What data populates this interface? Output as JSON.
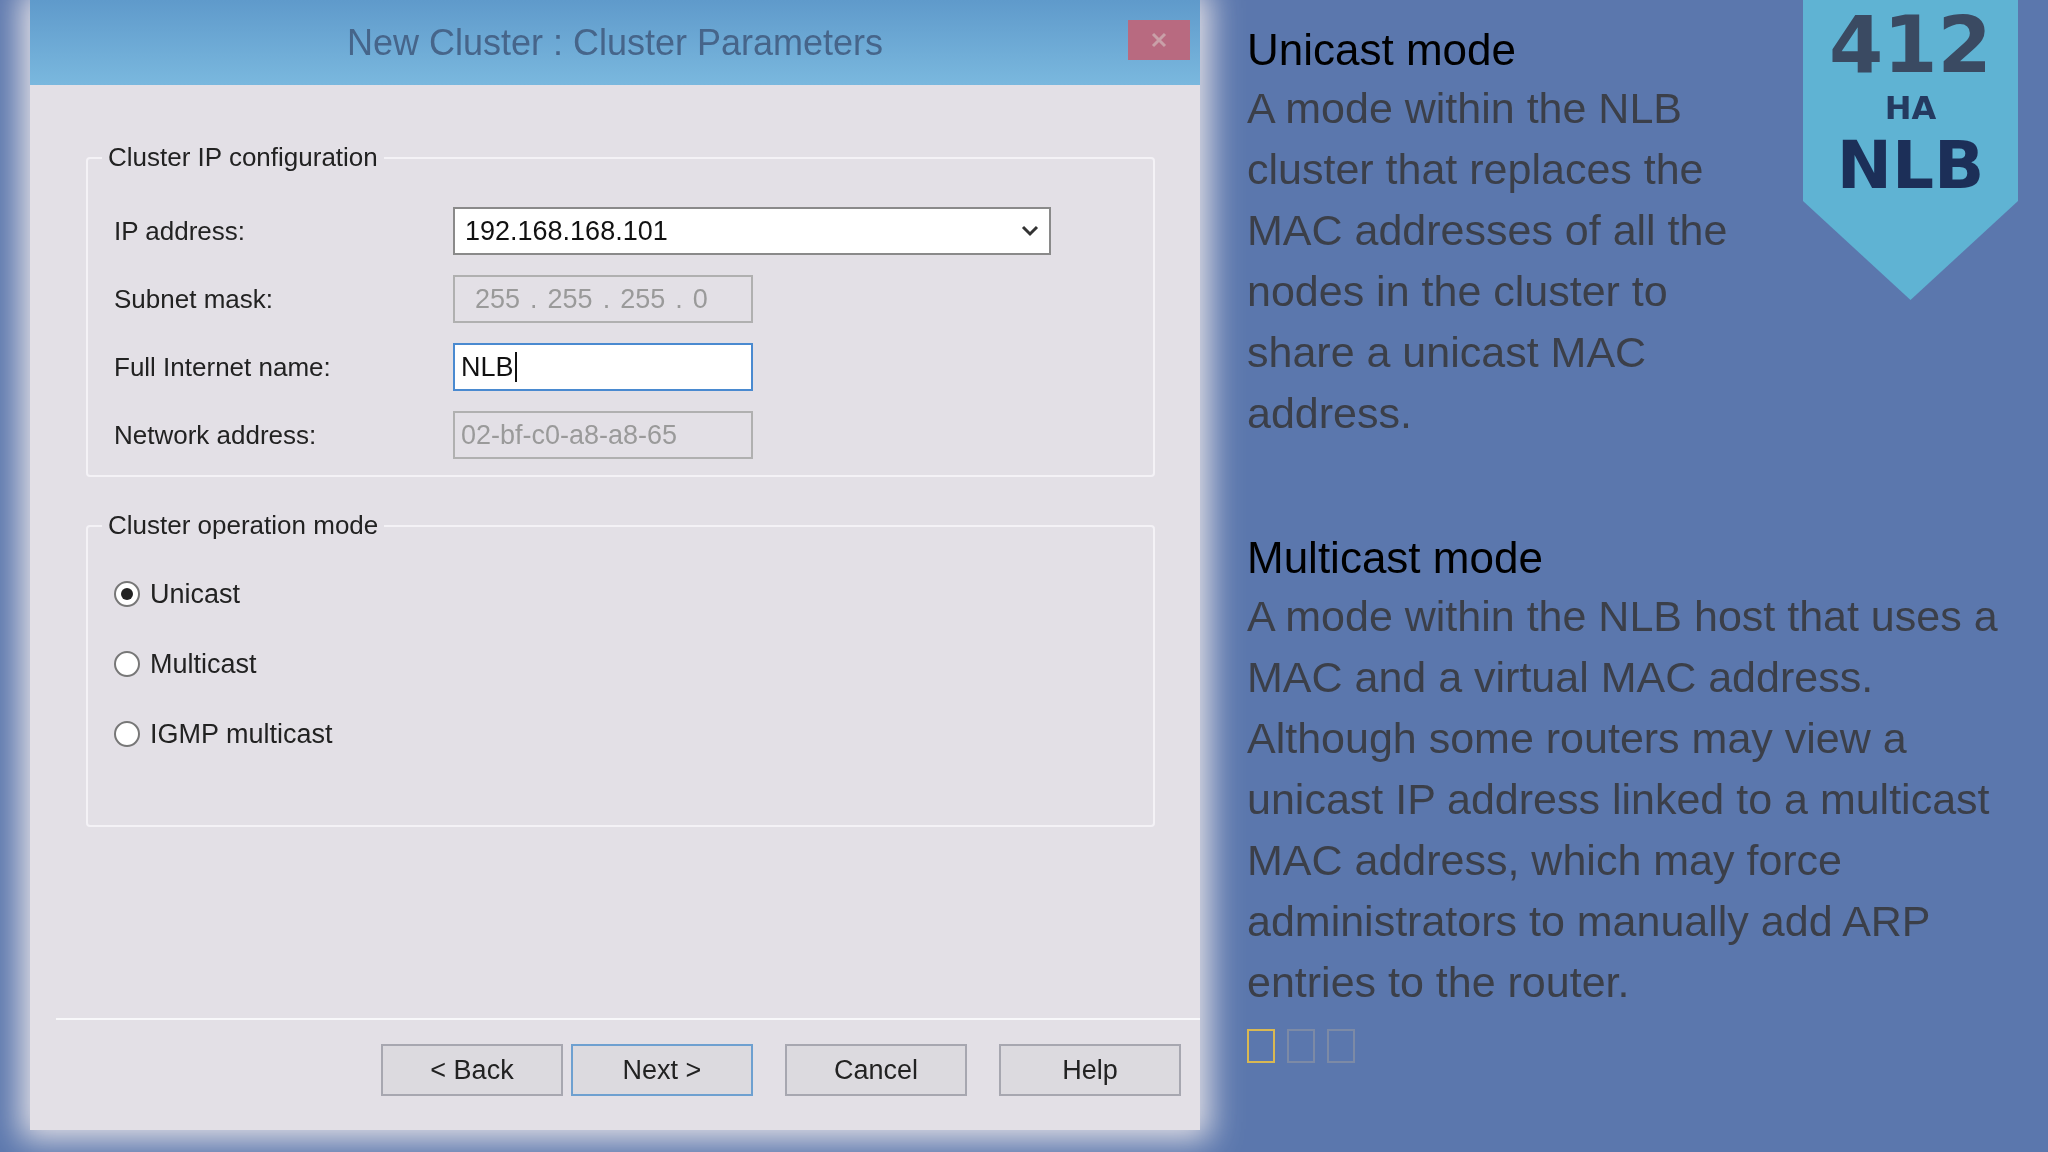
{
  "dialog": {
    "title": "New Cluster :  Cluster Parameters",
    "ip_group": {
      "legend": "Cluster IP configuration",
      "fields": [
        {
          "kind": "combo",
          "label": "IP address:",
          "value": "192.168.168.101"
        },
        {
          "kind": "ip",
          "label": "Subnet mask:",
          "octets": [
            "255",
            "255",
            "255",
            "0"
          ],
          "separators": [
            ".",
            ".",
            "."
          ],
          "disabled": true
        },
        {
          "kind": "text",
          "label": "Full Internet name:",
          "value": "NLB",
          "focused": true
        },
        {
          "kind": "text",
          "label": "Network address:",
          "value": "02-bf-c0-a8-a8-65",
          "disabled": true
        }
      ]
    },
    "mode_group": {
      "legend": "Cluster operation mode",
      "options": [
        {
          "label": "Unicast",
          "selected": true
        },
        {
          "label": "Multicast",
          "selected": false
        },
        {
          "label": "IGMP multicast",
          "selected": false
        }
      ]
    },
    "buttons": [
      "< Back",
      "Next >",
      "Cancel",
      "Help"
    ]
  },
  "sections": [
    {
      "heading": "Unicast mode",
      "body": "A mode within the NLB cluster that replaces the MAC addresses of all the nodes in the cluster to share a unicast MAC address.",
      "narrow": true
    },
    {
      "heading": "Multicast mode",
      "body": "A mode within the NLB host that uses a MAC and a virtual MAC address. Although some routers may view a unicast IP address linked to a multicast MAC address, which may force administrators to manually add ARP entries to the router.",
      "narrow": false
    }
  ],
  "slide_dots": [
    {
      "selected": true
    },
    {
      "selected": false
    },
    {
      "selected": false
    }
  ],
  "badge": {
    "number": "412",
    "subtitle": "HA",
    "title": "NLB"
  }
}
